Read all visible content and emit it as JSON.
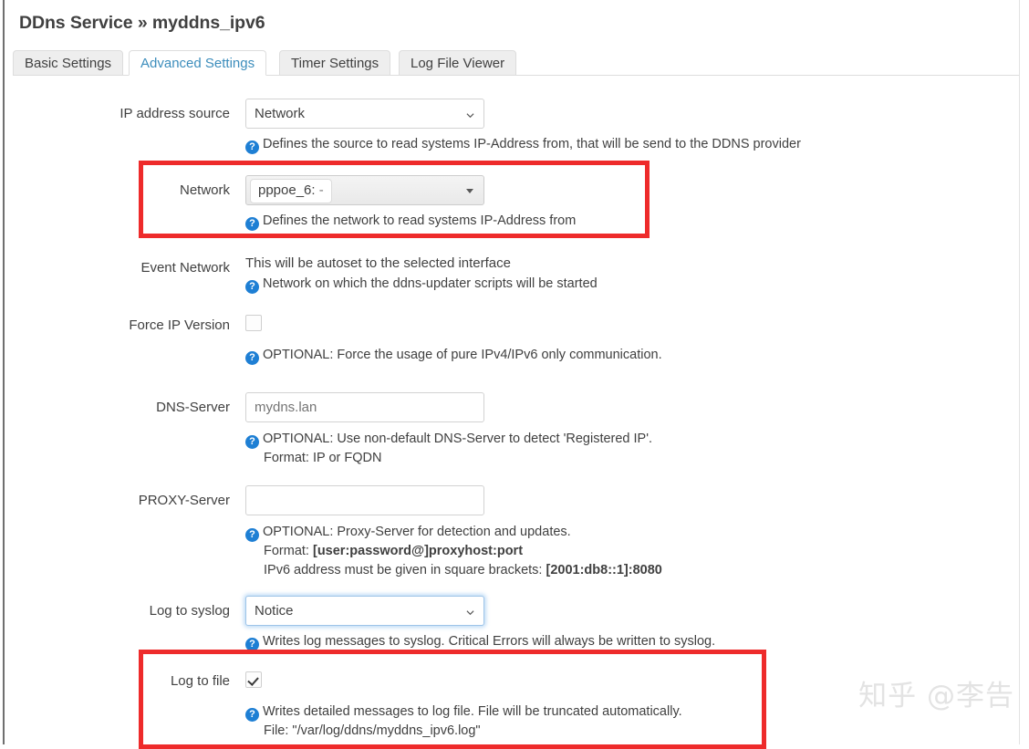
{
  "page": {
    "title": "DDns Service » myddns_ipv6",
    "watermark": "知乎 @李告"
  },
  "tabs": [
    {
      "label": "Basic Settings",
      "active": false
    },
    {
      "label": "Advanced Settings",
      "active": true
    },
    {
      "label": "Timer Settings",
      "active": false
    },
    {
      "label": "Log File Viewer",
      "active": false
    }
  ],
  "colors": {
    "accent_blue": "#3c8dbc",
    "help_icon_blue": "#1e7fd4",
    "highlight_red": "#ee2b2b",
    "text": "#404040"
  },
  "form": {
    "ip_address_source": {
      "label": "IP address source",
      "value": "Network",
      "help": "Defines the source to read systems IP-Address from, that will be send to the DDNS provider"
    },
    "network": {
      "label": "Network",
      "token_name": "pppoe_6:",
      "token_value": "-",
      "help": "Defines the network to read systems IP-Address from"
    },
    "event_network": {
      "label": "Event Network",
      "value": "This will be autoset to the selected interface",
      "help": "Network on which the ddns-updater scripts will be started"
    },
    "force_ip_version": {
      "label": "Force IP Version",
      "checked": false,
      "help": "OPTIONAL: Force the usage of pure IPv4/IPv6 only communication."
    },
    "dns_server": {
      "label": "DNS-Server",
      "value": "",
      "placeholder": "mydns.lan",
      "help": "OPTIONAL: Use non-default DNS-Server to detect 'Registered IP'.",
      "help_line2": "Format: IP or FQDN"
    },
    "proxy_server": {
      "label": "PROXY-Server",
      "value": "",
      "placeholder": "",
      "help": "OPTIONAL: Proxy-Server for detection and updates.",
      "help_line2_prefix": "Format: ",
      "help_line2_bold": "[user:password@]proxyhost:port",
      "help_line3_prefix": "IPv6 address must be given in square brackets: ",
      "help_line3_bold": "[2001:db8::1]:8080"
    },
    "log_to_syslog": {
      "label": "Log to syslog",
      "value": "Notice",
      "help": "Writes log messages to syslog. Critical Errors will always be written to syslog."
    },
    "log_to_file": {
      "label": "Log to file",
      "checked": true,
      "help": "Writes detailed messages to log file. File will be truncated automatically.",
      "help_line2": "File: \"/var/log/ddns/myddns_ipv6.log\""
    }
  },
  "icons": {
    "help": "?",
    "chevron_down": "chevron-down-icon",
    "caret_down": "caret-down-icon",
    "checkmark": "check-icon"
  }
}
